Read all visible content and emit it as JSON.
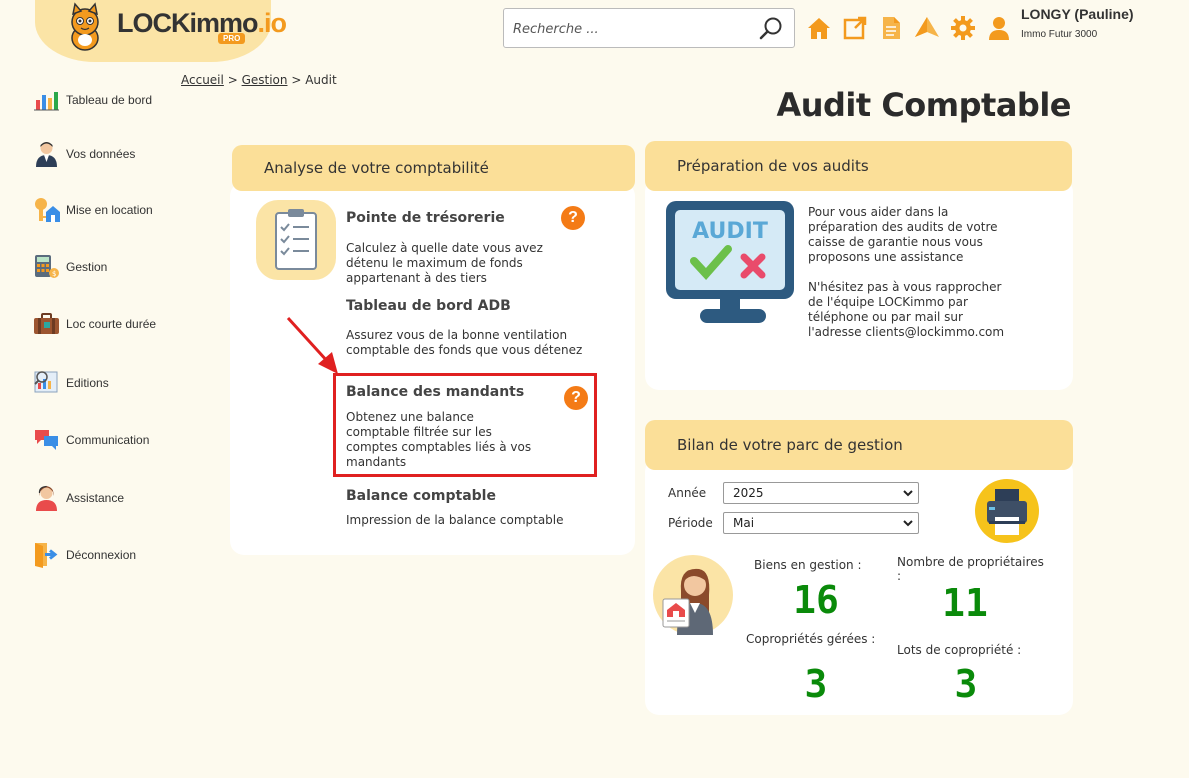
{
  "brand": {
    "logo_main": "LOCKimmo",
    "logo_suffix": ".io",
    "logo_badge": "PRO"
  },
  "search": {
    "placeholder": "Recherche ..."
  },
  "header_icons": [
    "home-icon",
    "external-link-icon",
    "document-icon",
    "notification-icon",
    "settings-icon",
    "user-icon"
  ],
  "user": {
    "name": "LONGY (Pauline)",
    "agency": "Immo Futur 3000"
  },
  "sidebar": {
    "items": [
      {
        "label": "Tableau de bord",
        "icon": "dashboard-icon"
      },
      {
        "label": "Vos données",
        "icon": "person-icon"
      },
      {
        "label": "Mise en location",
        "icon": "key-house-icon"
      },
      {
        "label": "Gestion",
        "icon": "calculator-icon"
      },
      {
        "label": "Loc courte durée",
        "icon": "suitcase-icon"
      },
      {
        "label": "Editions",
        "icon": "report-icon"
      },
      {
        "label": "Communication",
        "icon": "chat-icon"
      },
      {
        "label": "Assistance",
        "icon": "support-icon"
      },
      {
        "label": "Déconnexion",
        "icon": "logout-icon"
      }
    ]
  },
  "breadcrumb": {
    "home": "Accueil",
    "sep1": ">",
    "section": "Gestion",
    "sep2": ">",
    "current": "Audit"
  },
  "page_title": "Audit Comptable",
  "analyse": {
    "title": "Analyse de votre comptabilité",
    "items": [
      {
        "title": "Pointe de trésorerie",
        "desc_lines": [
          "Calculez à quelle date vous avez",
          "détenu le maximum de fonds",
          "appartenant à des tiers"
        ],
        "help": "?"
      },
      {
        "title": "Tableau de bord ADB",
        "desc_lines": [
          "Assurez vous de la bonne ventilation",
          "comptable des fonds que vous détenez"
        ]
      },
      {
        "title": "Balance des mandants",
        "desc_lines": [
          "Obtenez une balance",
          "comptable filtrée sur les",
          "comptes comptables liés à vos",
          "mandants"
        ],
        "help": "?"
      },
      {
        "title": "Balance comptable",
        "desc_lines": [
          "Impression de la balance comptable"
        ]
      }
    ]
  },
  "preparation": {
    "title": "Préparation de vos audits",
    "illustration_label": "AUDIT",
    "para1_lines": [
      "Pour vous aider dans la",
      "préparation des audits de votre",
      "caisse de garantie nous vous",
      "proposons une assistance"
    ],
    "para2_lines": [
      "N'hésitez pas à vous rapprocher",
      "de l'équipe LOCKimmo par",
      "téléphone ou par mail sur",
      "l'adresse clients@lockimmo.com"
    ]
  },
  "bilan": {
    "title": "Bilan de votre parc de gestion",
    "annee_label": "Année",
    "annee_value": "2025",
    "periode_label": "Période",
    "periode_value": "Mai",
    "stats": {
      "biens_label": "Biens en gestion :",
      "biens_value": "16",
      "proprietaires_label_line1": "Nombre de propriétaires",
      "proprietaires_label_line2": ":",
      "proprietaires_value": "11",
      "coproprietes_label": "Copropriétés gérées :",
      "coproprietes_value": "3",
      "lots_label": "Lots de copropriété :",
      "lots_value": "3"
    }
  },
  "colors": {
    "background": "#fdfaee",
    "panel_header": "#fbdf98",
    "accent_orange": "#f39a1e",
    "help_orange": "#f47b16",
    "stat_green": "#0a8a0a",
    "highlight_red": "#e02020"
  }
}
